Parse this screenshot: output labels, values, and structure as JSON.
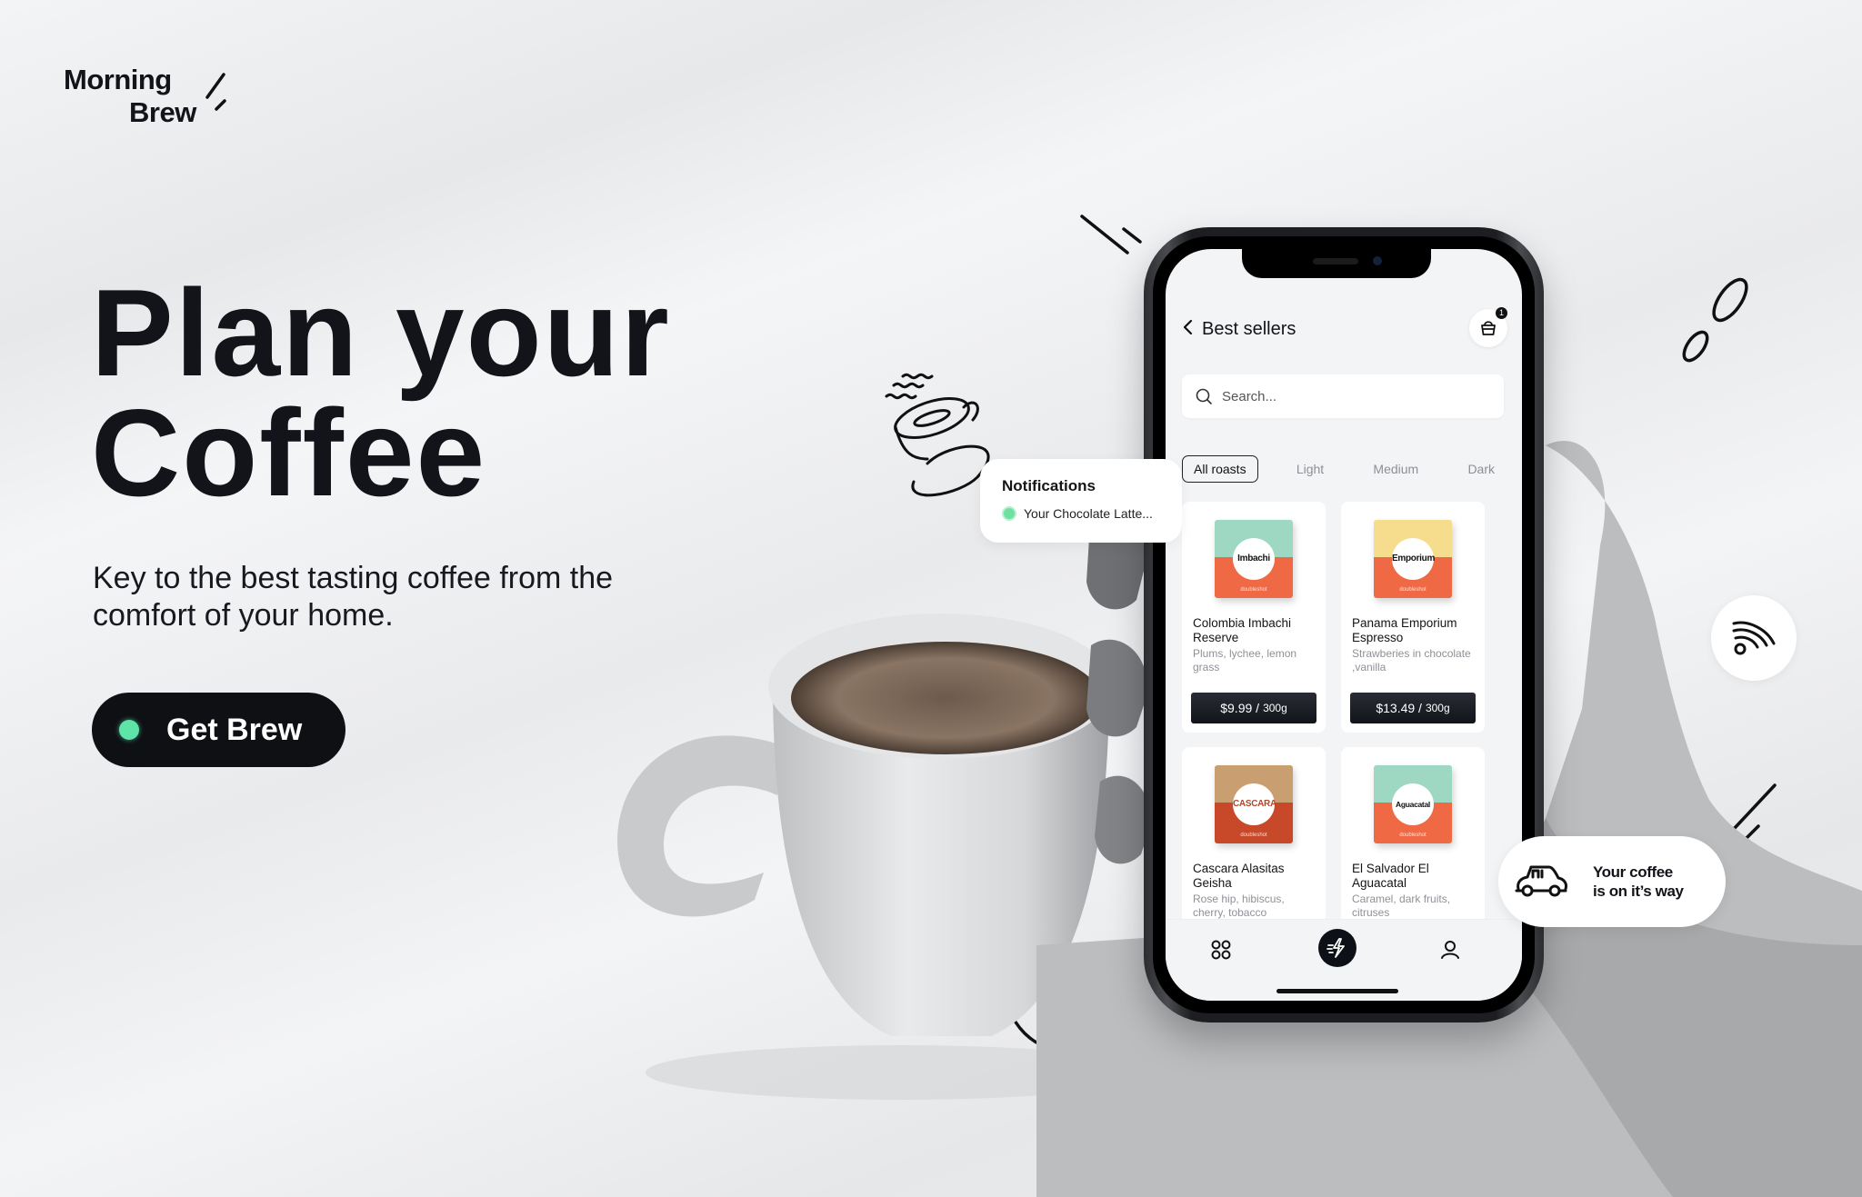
{
  "logo": {
    "line1": "Morning",
    "line2": "Brew"
  },
  "hero": {
    "title_line1": "Plan your",
    "title_line2": "Coffee",
    "subtitle": "Key to the best tasting coffee from the comfort of your home.",
    "cta_label": "Get Brew",
    "cta_dot_color": "#5ee3a9"
  },
  "notification": {
    "title": "Notifications",
    "message": "Your Chocolate Latte..."
  },
  "delivery": {
    "line1": "Your coffee",
    "line2": "is on it’s way",
    "icon": "car-icon"
  },
  "nfc_button": {
    "icon": "contactless-icon"
  },
  "phone": {
    "header": {
      "back_icon": "chevron-left-icon",
      "title": "Best sellers",
      "cart_icon": "shopping-bag-icon",
      "cart_count": "1"
    },
    "search": {
      "placeholder": "Search...",
      "value": ""
    },
    "filters": [
      {
        "label": "All roasts",
        "active": true
      },
      {
        "label": "Light",
        "active": false
      },
      {
        "label": "Medium",
        "active": false
      },
      {
        "label": "Dark",
        "active": false
      }
    ],
    "products": [
      {
        "bag_label": "Imbachi",
        "bag_brand": "doubleshot",
        "bag_top": "#9ed8c2",
        "bag_bottom": "#ef6a44",
        "name": "Colombia Imbachi Reserve",
        "notes": "Plums, lychee, lemon grass",
        "price": "$9.99 /",
        "unit": "300g"
      },
      {
        "bag_label": "Emporium",
        "bag_brand": "doubleshot",
        "bag_top": "#f6dd8e",
        "bag_bottom": "#ef6a44",
        "name": "Panama Emporium Espresso",
        "notes": "Strawberies in chocolate ,vanilla",
        "price": "$13.49 /",
        "unit": "300g"
      },
      {
        "bag_label": "CASCARA",
        "bag_brand": "doubleshot",
        "bag_top": "#c99e70",
        "bag_bottom": "#c8492a",
        "name": "Cascara Alasitas Geisha",
        "notes": "Rose hip, hibiscus, cherry, tobacco",
        "price": "",
        "unit": ""
      },
      {
        "bag_label": "Aguacatal",
        "bag_brand": "doubleshot",
        "bag_top": "#9ed8c2",
        "bag_bottom": "#ef6a44",
        "name": "El Salvador El Aguacatal",
        "notes": "Caramel, dark fruits, citruses",
        "price": "",
        "unit": ""
      }
    ],
    "tabbar": [
      {
        "icon": "grid-icon"
      },
      {
        "icon": "lightning-icon",
        "active": true
      },
      {
        "icon": "user-icon"
      }
    ]
  }
}
